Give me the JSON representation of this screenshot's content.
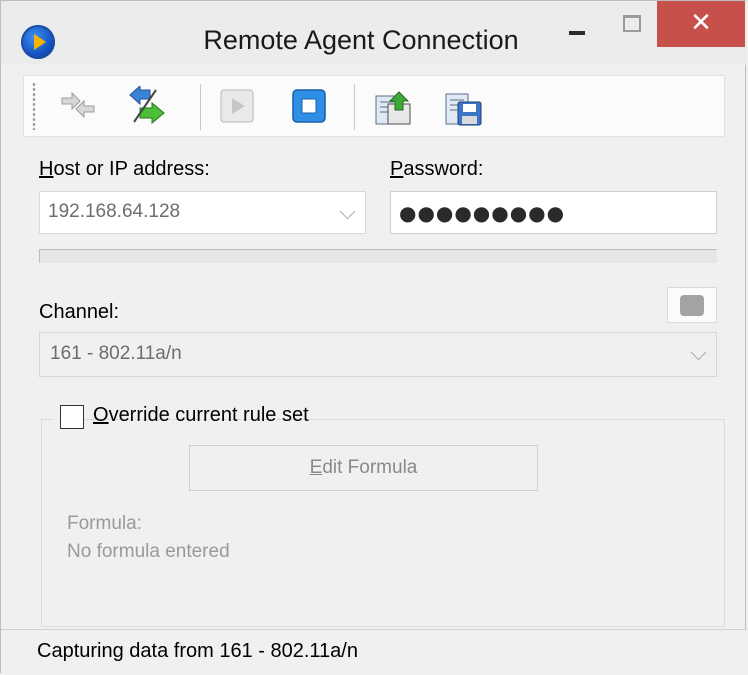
{
  "window": {
    "title": "Remote Agent Connection",
    "close_glyph": "✕"
  },
  "toolbar": {
    "buttons": [
      {
        "name": "disconnect",
        "icon": "disconnect-arrows-icon",
        "enabled": false
      },
      {
        "name": "connect",
        "icon": "connect-arrows-icon",
        "enabled": true
      },
      {
        "name": "start-capture",
        "icon": "play-icon",
        "enabled": false
      },
      {
        "name": "stop-capture",
        "icon": "stop-icon",
        "enabled": true
      },
      {
        "name": "load-settings",
        "icon": "open-file-icon",
        "enabled": true
      },
      {
        "name": "save-settings",
        "icon": "save-file-icon",
        "enabled": true
      }
    ]
  },
  "form": {
    "host_label_accel": "H",
    "host_label_rest": "ost or IP address:",
    "host_value": "192.168.64.128",
    "password_label_accel": "P",
    "password_label_rest": "assword:",
    "password_value": "●●●●●●●●●",
    "progress": 0,
    "channel_label": "Channel:",
    "channel_value": "161 - 802.11a/n"
  },
  "override": {
    "label_accel": "O",
    "label_rest": "verride current rule set",
    "checked": false,
    "edit_button_accel": "E",
    "edit_button_rest": "dit Formula",
    "formula_label": "Formula:",
    "formula_value": "No formula entered"
  },
  "status": {
    "text": "Capturing data from 161 - 802.11a/n"
  },
  "colors": {
    "close_button": "#c7504b",
    "progress_fill": "#06b025",
    "status_indicator": "#a3a3a3"
  }
}
